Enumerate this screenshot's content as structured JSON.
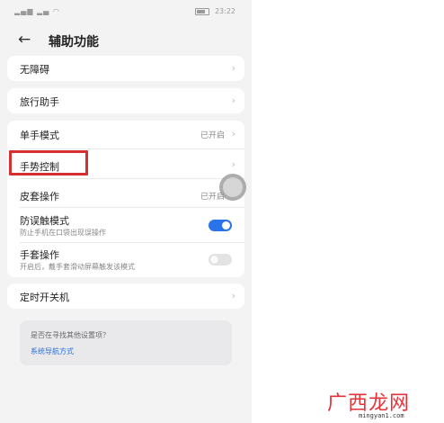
{
  "status_bar": {
    "signal": "▂▄▆ ▂▄ ◠",
    "time": "23:22"
  },
  "header": {
    "back_icon": "arrow-left",
    "title": "辅助功能"
  },
  "items": {
    "barrier_free": {
      "label": "无障碍"
    },
    "travel_assistant": {
      "label": "旅行助手"
    },
    "one_hand": {
      "label": "单手模式",
      "value": "已开启"
    },
    "gesture_control": {
      "label": "手势控制"
    },
    "cover_operation": {
      "label": "皮套操作",
      "value": "已开启"
    },
    "anti_mistouch": {
      "label": "防误触模式",
      "description": "防止手机在口袋出现误操作",
      "enabled": true
    },
    "glove_mode": {
      "label": "手套操作",
      "description": "开启后，戴手套滑动屏幕触发该模式",
      "enabled": false
    },
    "scheduled_power": {
      "label": "定时开关机"
    }
  },
  "suggestion": {
    "question": "是否在寻找其他设置项？",
    "link": "系统导航方式"
  },
  "watermark": {
    "brand": "广西龙网",
    "url": "mingyan1.com"
  },
  "colors": {
    "accent": "#2a73e8",
    "highlight": "#d62f2f",
    "link": "#2a6fd6"
  }
}
